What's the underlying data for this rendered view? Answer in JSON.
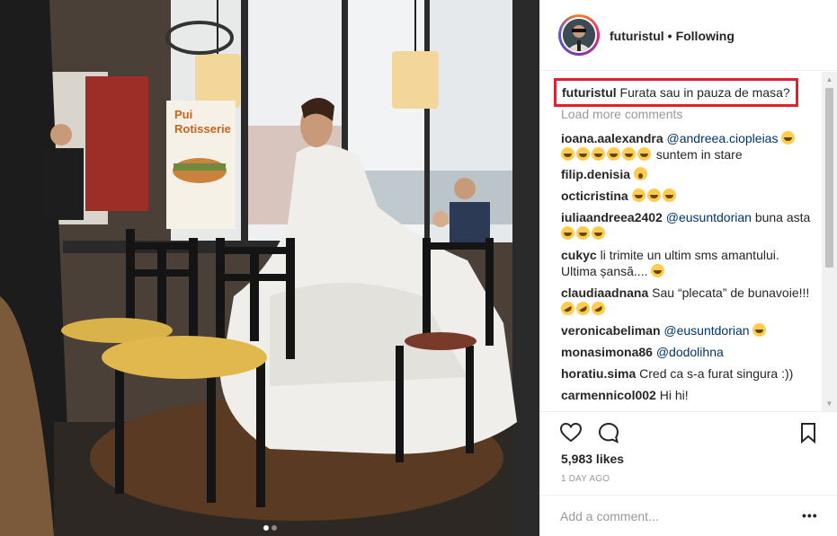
{
  "header": {
    "username": "futuristul",
    "separator": "•",
    "follow_status": "Following"
  },
  "photo": {
    "sign_line1": "Pui",
    "sign_line2": "Rotisserie",
    "slide": 1,
    "slide_count": 2
  },
  "caption": {
    "username": "futuristul",
    "text": "Furata sau in pauza de masa?"
  },
  "load_more": "Load more comments",
  "comments": [
    {
      "username": "ioana.aalexandra",
      "mention": "@andreea.ciopleias",
      "emoji_after_mention": 1,
      "line2_emoji": 6,
      "text": "suntem in stare"
    },
    {
      "username": "filip.denisia",
      "emoji_wow": 1
    },
    {
      "username": "octicristina",
      "emoji": 3
    },
    {
      "username": "iuliaandreea2402",
      "mention": "@eusuntdorian",
      "text": "buna asta",
      "emoji": 3
    },
    {
      "username": "cukyc",
      "text": "li trimite un ultim sms amantului. Ultima șansă....",
      "emoji": 1
    },
    {
      "username": "claudiaadnana",
      "text": "Sau “plecata” de bunavoie!!!",
      "emoji_rofl": 3
    },
    {
      "username": "veronicabeliman",
      "mention": "@eusuntdorian",
      "emoji": 1
    },
    {
      "username": "monasimona86",
      "mention": "@dodolihna"
    },
    {
      "username": "horatiu.sima",
      "text": "Cred ca s-a furat singura :))"
    },
    {
      "username": "carmennicol002",
      "text": "Hi hi!"
    }
  ],
  "actions": {
    "like_icon": "heart-icon",
    "comment_icon": "comment-icon",
    "save_icon": "bookmark-icon"
  },
  "likes": "5,983 likes",
  "timestamp": "1 DAY AGO",
  "add_comment": {
    "placeholder": "Add a comment...",
    "more_label": "•••"
  },
  "colors": {
    "highlight_border": "#e0202c",
    "mention": "#003569",
    "muted": "#999999"
  }
}
